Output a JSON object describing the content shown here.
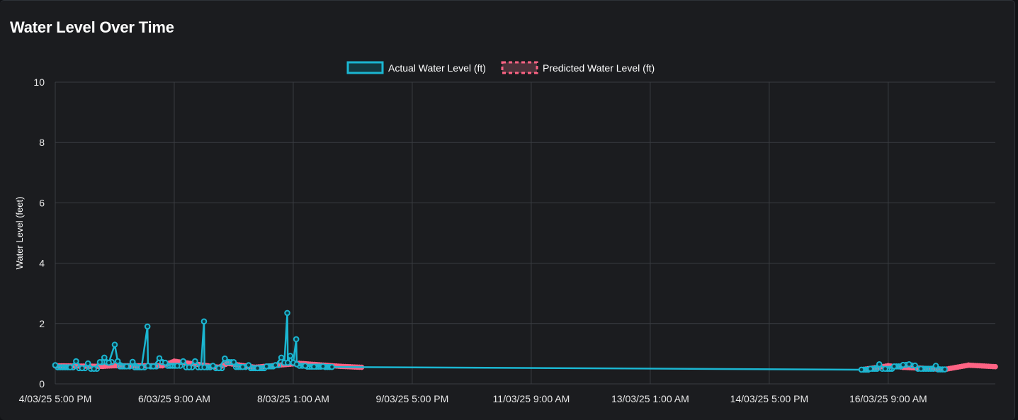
{
  "card": {
    "title": "Water Level Over Time"
  },
  "colors": {
    "actual": "#1bb6d1",
    "predicted": "#ff6384",
    "predicted_fill": "#4a3139",
    "grid": "#3a3d42",
    "background": "#1b1c1f"
  },
  "chart_data": {
    "type": "line",
    "title": "Water Level Over Time",
    "ylabel": "Water Level (feet)",
    "xlabel": "",
    "ylim": [
      0,
      10
    ],
    "yticks": [
      0,
      2,
      4,
      6,
      8,
      10
    ],
    "xlim": [
      "2025-03-04T17:00",
      "2025-03-17T21:00"
    ],
    "xticks": [
      {
        "t": "2025-03-04T17:00",
        "label": "4/03/25 5:00 PM"
      },
      {
        "t": "2025-03-06T09:00",
        "label": "6/03/25 9:00 AM"
      },
      {
        "t": "2025-03-08T01:00",
        "label": "8/03/25 1:00 AM"
      },
      {
        "t": "2025-03-09T17:00",
        "label": "9/03/25 5:00 PM"
      },
      {
        "t": "2025-03-11T09:00",
        "label": "11/03/25 9:00 AM"
      },
      {
        "t": "2025-03-13T01:00",
        "label": "13/03/25 1:00 AM"
      },
      {
        "t": "2025-03-14T17:00",
        "label": "14/03/25 5:00 PM"
      },
      {
        "t": "2025-03-16T09:00",
        "label": "16/03/25 9:00 AM"
      }
    ],
    "grid": true,
    "legend_position": "top-center",
    "series": [
      {
        "name": "Actual Water Level (ft)",
        "style": "solid",
        "points": [
          [
            "2025-03-04T17:00",
            0.62
          ],
          [
            "2025-03-04T22:00",
            0.55
          ],
          [
            "2025-03-05T00:00",
            0.75
          ],
          [
            "2025-03-05T02:00",
            0.52
          ],
          [
            "2025-03-05T04:00",
            0.68
          ],
          [
            "2025-03-05T06:00",
            0.5
          ],
          [
            "2025-03-05T08:00",
            0.72
          ],
          [
            "2025-03-05T09:30",
            0.87
          ],
          [
            "2025-03-05T11:00",
            0.7
          ],
          [
            "2025-03-05T13:00",
            1.3
          ],
          [
            "2025-03-05T14:00",
            0.75
          ],
          [
            "2025-03-05T17:00",
            0.58
          ],
          [
            "2025-03-05T19:00",
            0.73
          ],
          [
            "2025-03-05T22:00",
            0.55
          ],
          [
            "2025-03-06T00:00",
            1.9
          ],
          [
            "2025-03-06T00:10",
            0.6
          ],
          [
            "2025-03-06T02:00",
            0.58
          ],
          [
            "2025-03-06T04:00",
            0.85
          ],
          [
            "2025-03-06T06:00",
            0.7
          ],
          [
            "2025-03-06T10:00",
            0.6
          ],
          [
            "2025-03-06T12:00",
            0.75
          ],
          [
            "2025-03-06T14:00",
            0.55
          ],
          [
            "2025-03-06T16:00",
            0.75
          ],
          [
            "2025-03-06T18:00",
            0.55
          ],
          [
            "2025-03-06T19:00",
            2.07
          ],
          [
            "2025-03-06T19:10",
            0.55
          ],
          [
            "2025-03-06T22:00",
            0.6
          ],
          [
            "2025-03-07T00:00",
            0.52
          ],
          [
            "2025-03-07T02:00",
            0.84
          ],
          [
            "2025-03-07T05:00",
            0.72
          ],
          [
            "2025-03-07T08:00",
            0.56
          ],
          [
            "2025-03-07T10:00",
            0.62
          ],
          [
            "2025-03-07T13:00",
            0.52
          ],
          [
            "2025-03-07T16:00",
            0.58
          ],
          [
            "2025-03-07T19:00",
            0.62
          ],
          [
            "2025-03-07T21:00",
            0.87
          ],
          [
            "2025-03-07T22:00",
            0.7
          ],
          [
            "2025-03-07T23:00",
            2.35
          ],
          [
            "2025-03-07T23:10",
            0.7
          ],
          [
            "2025-03-08T00:00",
            0.93
          ],
          [
            "2025-03-08T01:00",
            0.7
          ],
          [
            "2025-03-08T02:00",
            1.48
          ],
          [
            "2025-03-08T02:10",
            0.65
          ],
          [
            "2025-03-08T05:00",
            0.6
          ],
          [
            "2025-03-08T08:00",
            0.57
          ],
          [
            "2025-03-08T11:00",
            0.58
          ],
          [
            "2025-03-08T14:00",
            0.56
          ],
          [
            "2025-03-16T00:00",
            0.47
          ],
          [
            "2025-03-16T03:00",
            0.5
          ],
          [
            "2025-03-16T06:00",
            0.65
          ],
          [
            "2025-03-16T08:00",
            0.5
          ],
          [
            "2025-03-16T11:00",
            0.58
          ],
          [
            "2025-03-16T14:00",
            0.63
          ],
          [
            "2025-03-16T16:00",
            0.65
          ],
          [
            "2025-03-16T18:00",
            0.61
          ],
          [
            "2025-03-16T20:00",
            0.5
          ],
          [
            "2025-03-17T01:00",
            0.6
          ],
          [
            "2025-03-17T04:00",
            0.48
          ]
        ]
      },
      {
        "name": "Predicted Water Level (ft)",
        "style": "dashed",
        "points": [
          [
            "2025-03-04T17:00",
            0.6
          ],
          [
            "2025-03-05T09:00",
            0.58
          ],
          [
            "2025-03-05T12:00",
            0.6
          ],
          [
            "2025-03-06T05:00",
            0.6
          ],
          [
            "2025-03-06T09:00",
            0.75
          ],
          [
            "2025-03-07T00:00",
            0.55
          ],
          [
            "2025-03-07T03:00",
            0.68
          ],
          [
            "2025-03-07T12:00",
            0.55
          ],
          [
            "2025-03-08T03:00",
            0.68
          ],
          [
            "2025-03-08T17:00",
            0.58
          ],
          [
            "2025-03-09T00:00",
            0.55
          ],
          [
            "2025-03-16T00:00",
            0.47
          ],
          [
            "2025-03-16T09:00",
            0.6
          ],
          [
            "2025-03-16T14:00",
            0.55
          ],
          [
            "2025-03-17T04:00",
            0.48
          ],
          [
            "2025-03-17T12:00",
            0.62
          ],
          [
            "2025-03-17T21:00",
            0.57
          ]
        ]
      }
    ]
  }
}
